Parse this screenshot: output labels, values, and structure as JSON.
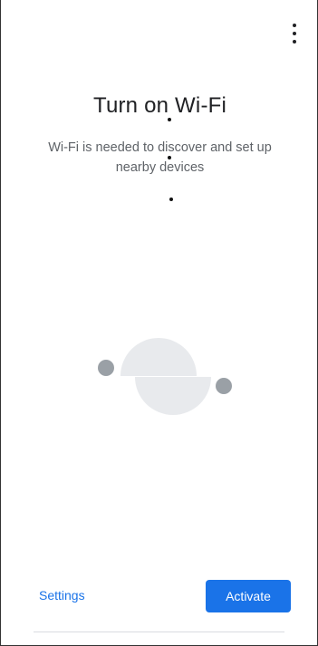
{
  "header": {
    "more_options_icon": "more-vert-icon"
  },
  "main": {
    "title": "Turn on Wi-Fi",
    "subtitle": "Wi-Fi is needed to discover and set up nearby devices",
    "illustration_icon": "wifi-devices-illustration"
  },
  "actions": {
    "settings_label": "Settings",
    "activate_label": "Activate"
  },
  "colors": {
    "accent": "#1a73e8",
    "illustration_light": "#e8eaed",
    "illustration_dark": "#9aa0a6"
  }
}
